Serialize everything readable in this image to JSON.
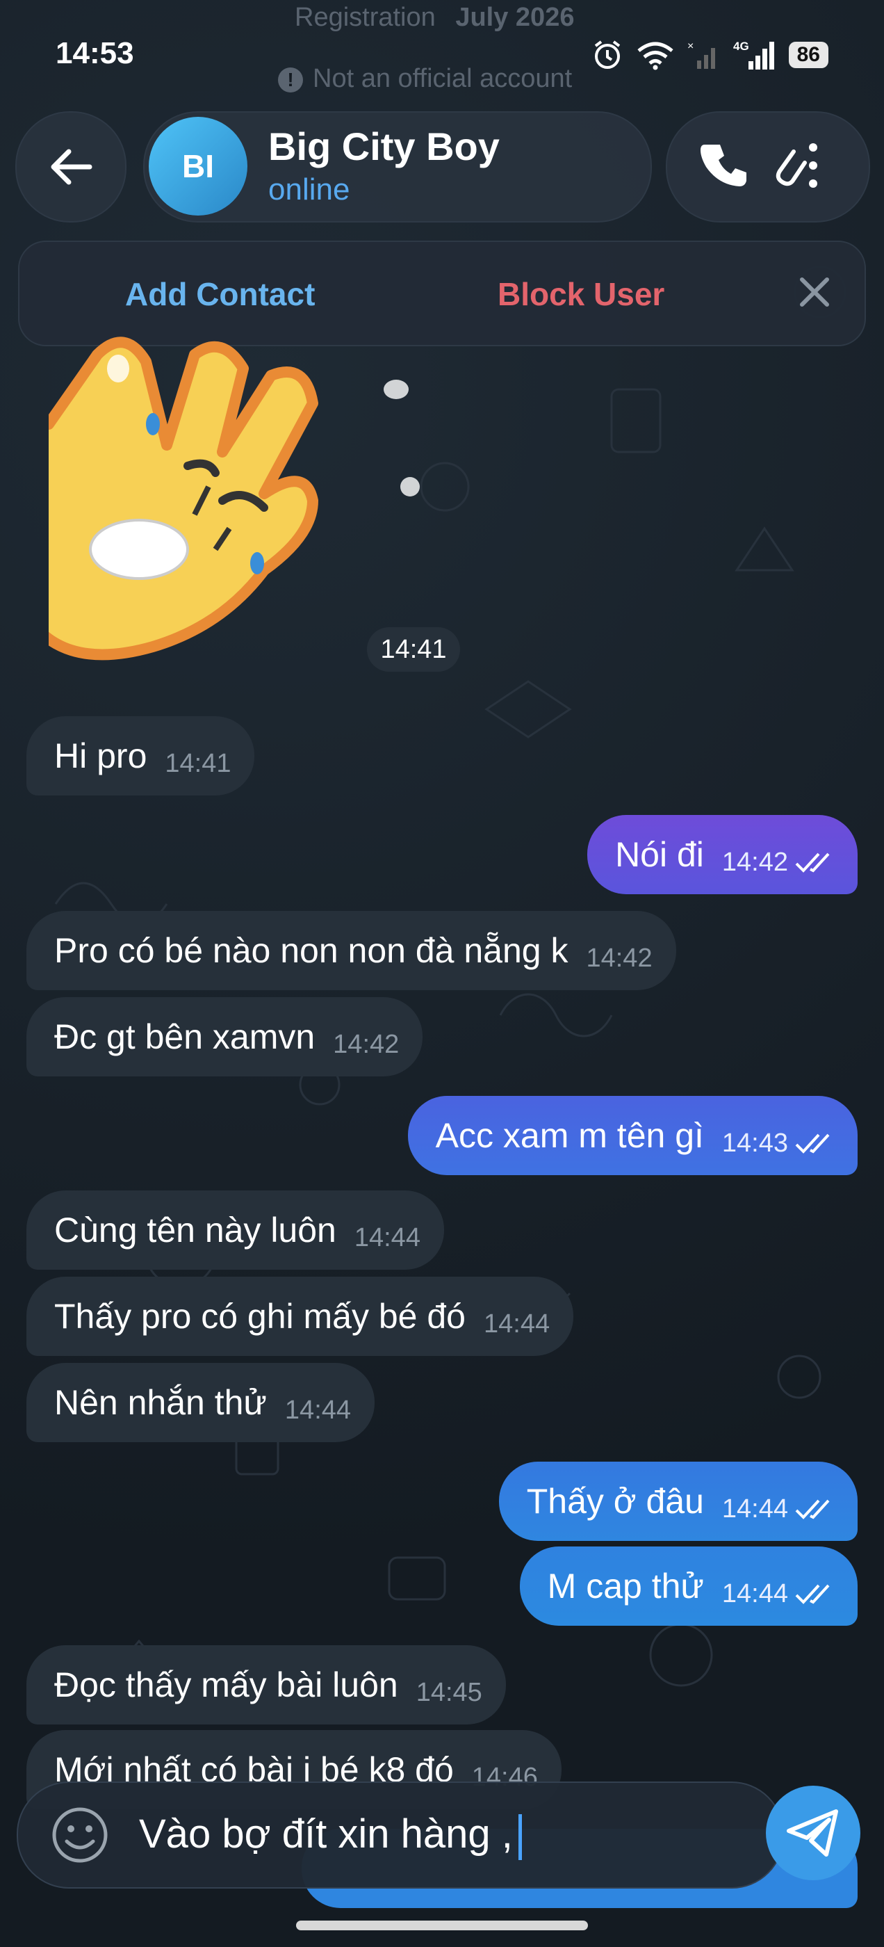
{
  "status_bar": {
    "time": "14:53",
    "battery": "86",
    "network": "4G"
  },
  "ghost_header": {
    "registration_label": "Registration",
    "registration_date": "July 2026",
    "official_notice": "Not an official account"
  },
  "header": {
    "avatar_initials": "BI",
    "contact_name": "Big City Boy",
    "contact_status": "online"
  },
  "banner": {
    "add_contact": "Add Contact",
    "block_user": "Block User"
  },
  "sticker": {
    "time": "14:41"
  },
  "messages": [
    {
      "dir": "in",
      "text": "Hi pro",
      "time": "14:41"
    },
    {
      "dir": "out",
      "text": "Nói đi",
      "time": "14:42",
      "read": true
    },
    {
      "dir": "in",
      "text": "Pro có bé nào non non đà nẵng k",
      "time": "14:42"
    },
    {
      "dir": "in",
      "text": "Đc gt bên xamvn",
      "time": "14:42"
    },
    {
      "dir": "out",
      "text": "Acc xam m tên gì",
      "time": "14:43",
      "read": true
    },
    {
      "dir": "in",
      "text": "Cùng tên này luôn",
      "time": "14:44"
    },
    {
      "dir": "in",
      "text": "Thấy pro có ghi mấy bé đó",
      "time": "14:44"
    },
    {
      "dir": "in",
      "text": "Nên nhắn thử",
      "time": "14:44"
    },
    {
      "dir": "out",
      "text": "Thấy ở đâu",
      "time": "14:44",
      "read": true
    },
    {
      "dir": "out",
      "text": "M cap thử",
      "time": "14:44",
      "read": true
    },
    {
      "dir": "in",
      "text": "Đọc thấy mấy bài luôn",
      "time": "14:45"
    },
    {
      "dir": "in",
      "text": "Mới nhất có bài i bé k8 đó",
      "time": "14:46"
    }
  ],
  "input": {
    "value": "Vào bợ đít xin hàng ,"
  },
  "colors": {
    "accent": "#3a9be8",
    "incoming_bubble": "#26303a",
    "outgoing_bubble_top": "#6b4fd8",
    "outgoing_bubble_bottom": "#2f86e0",
    "danger": "#e3646c"
  }
}
